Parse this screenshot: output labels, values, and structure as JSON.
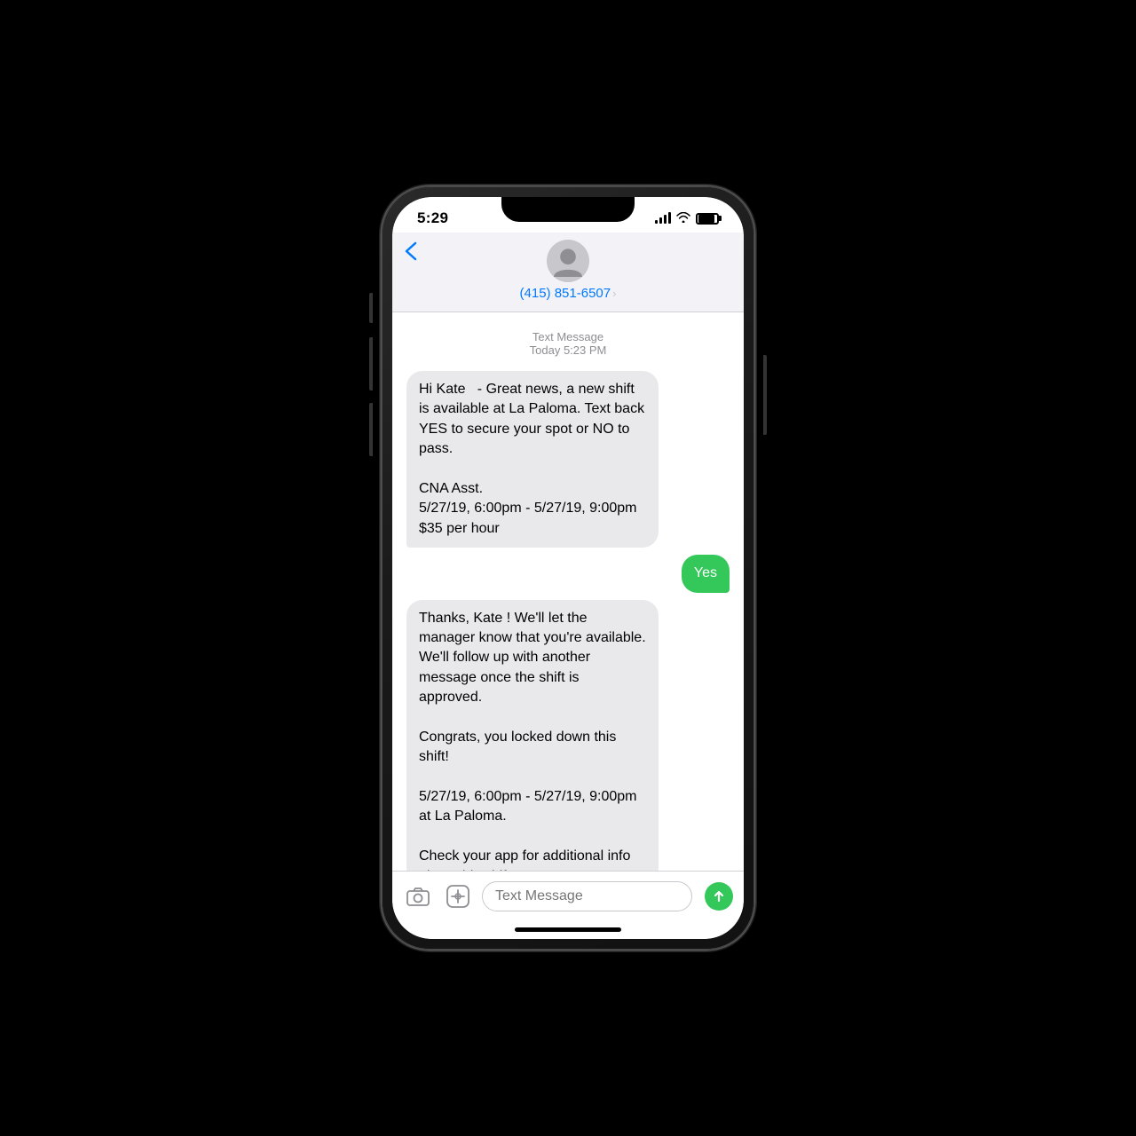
{
  "phone": {
    "status_bar": {
      "time": "5:29",
      "signal_label": "signal",
      "wifi_label": "wifi",
      "battery_label": "battery"
    },
    "nav": {
      "back_label": "‹",
      "phone_number": "(415) 851-6507",
      "chevron": "›"
    },
    "messages": {
      "meta_type": "Text Message",
      "meta_time": "Today 5:23 PM",
      "bubbles": [
        {
          "id": "msg1",
          "direction": "incoming",
          "text": "Hi Kate  - Great news, a new shift is available at La Paloma. Text back YES to secure your spot or NO to pass.\n\nCNA Asst.\n5/27/19, 6:00pm - 5/27/19, 9:00pm\n$35 per hour"
        },
        {
          "id": "msg2",
          "direction": "outgoing",
          "text": "Yes"
        },
        {
          "id": "msg3",
          "direction": "incoming",
          "text": "Thanks, Kate ! We'll let the manager know that you're available. We'll follow up with another message once the shift is approved.\n\nCongrats, you locked down this shift!\n\n5/27/19, 6:00pm - 5/27/19, 9:00pm at La Paloma.\n\nCheck your app for additional info about this shift."
        }
      ]
    },
    "input": {
      "placeholder": "Text Message",
      "camera_icon": "camera",
      "appstore_icon": "appstore",
      "send_icon": "send"
    }
  }
}
